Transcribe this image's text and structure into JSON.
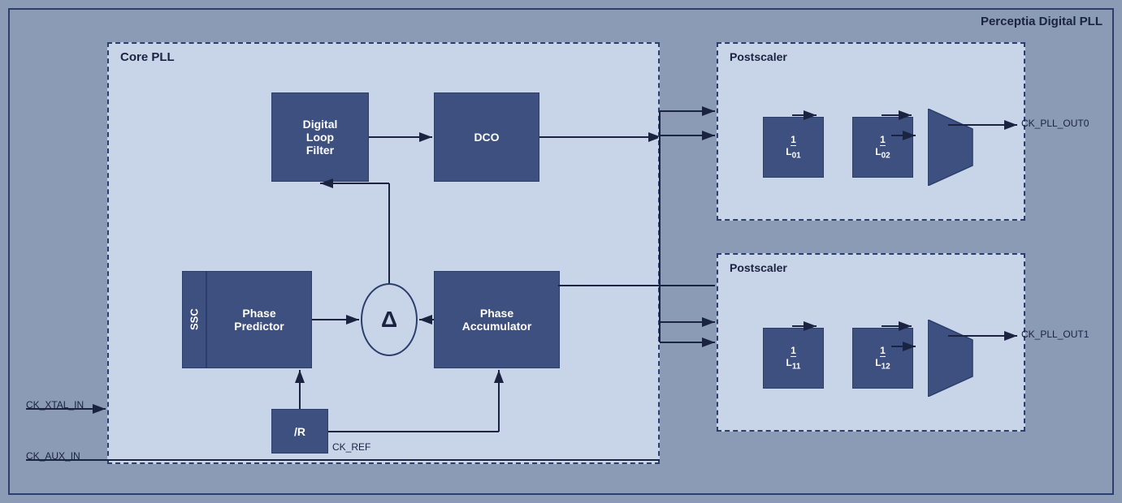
{
  "title": "Perceptia Digital PLL",
  "corePLL": {
    "label": "Core PLL",
    "blocks": {
      "dlf": "Digital\nLoop\nFilter",
      "dco": "DCO",
      "phasePredictor": "Phase\nPredictor",
      "phaseAccumulator": "Phase\nAccumulator",
      "ssc": "SSC",
      "dividerR": "/R",
      "delta": "Δ"
    }
  },
  "postscalerTop": {
    "label": "Postscaler",
    "div1": {
      "num": "1",
      "den": "L₀₁"
    },
    "div2": {
      "num": "1",
      "den": "L₀₂"
    },
    "output": "CK_PLL_OUT0"
  },
  "postscalerBottom": {
    "label": "Postscaler",
    "div1": {
      "num": "1",
      "den": "L₁₁"
    },
    "div2": {
      "num": "1",
      "den": "L₁₂"
    },
    "output": "CK_PLL_OUT1"
  },
  "signals": {
    "ck_xtal_in": "CK_XTAL_IN",
    "ck_aux_in": "CK_AUX_IN",
    "ck_ref": "CK_REF",
    "ck_pll_out0": "CK_PLL_OUT0",
    "ck_pll_out1": "CK_PLL_OUT1"
  }
}
